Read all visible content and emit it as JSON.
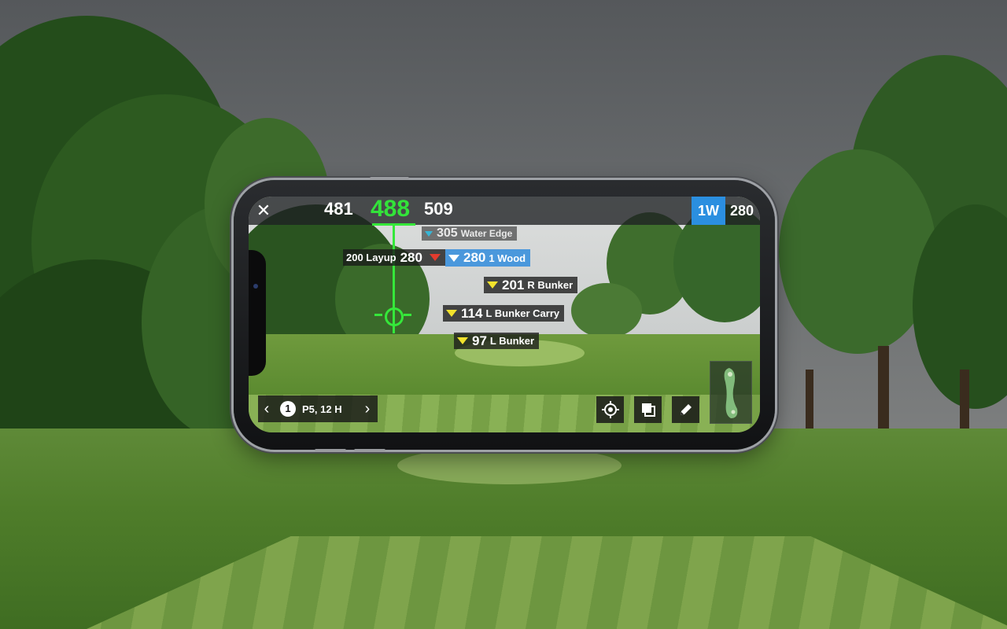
{
  "topbar": {
    "close_icon": "close-icon",
    "distance_back": "481",
    "distance_center": "488",
    "distance_front": "509",
    "club": "1W",
    "club_distance": "280"
  },
  "markers": {
    "water_edge": {
      "value": "305",
      "label": "Water Edge",
      "color": "#37b6d6"
    },
    "layup": {
      "label": "200 Layup",
      "value": "280",
      "color": "#e23b2e"
    },
    "one_wood": {
      "value": "280",
      "label": "1 Wood",
      "color": "#4a98dc"
    },
    "r_bunker": {
      "value": "201",
      "label": "R Bunker",
      "color": "#f2e22c"
    },
    "l_bunker_carry": {
      "value": "114",
      "label": "L Bunker Carry",
      "color": "#f2e22c"
    },
    "l_bunker": {
      "value": "97",
      "label": "L Bunker",
      "color": "#f2e22c"
    }
  },
  "hole_nav": {
    "prev_icon": "chevron-left-icon",
    "hole_number": "1",
    "hole_info": "P5, 12 H",
    "next_icon": "chevron-right-icon"
  },
  "controls": {
    "locate_icon": "crosshair-icon",
    "layers_icon": "layers-icon",
    "edit_icon": "pencil-icon",
    "map_icon": "hole-map-thumbnail"
  },
  "colors": {
    "aim_green": "#35e83a",
    "club_blue": "#2b8fe0"
  }
}
